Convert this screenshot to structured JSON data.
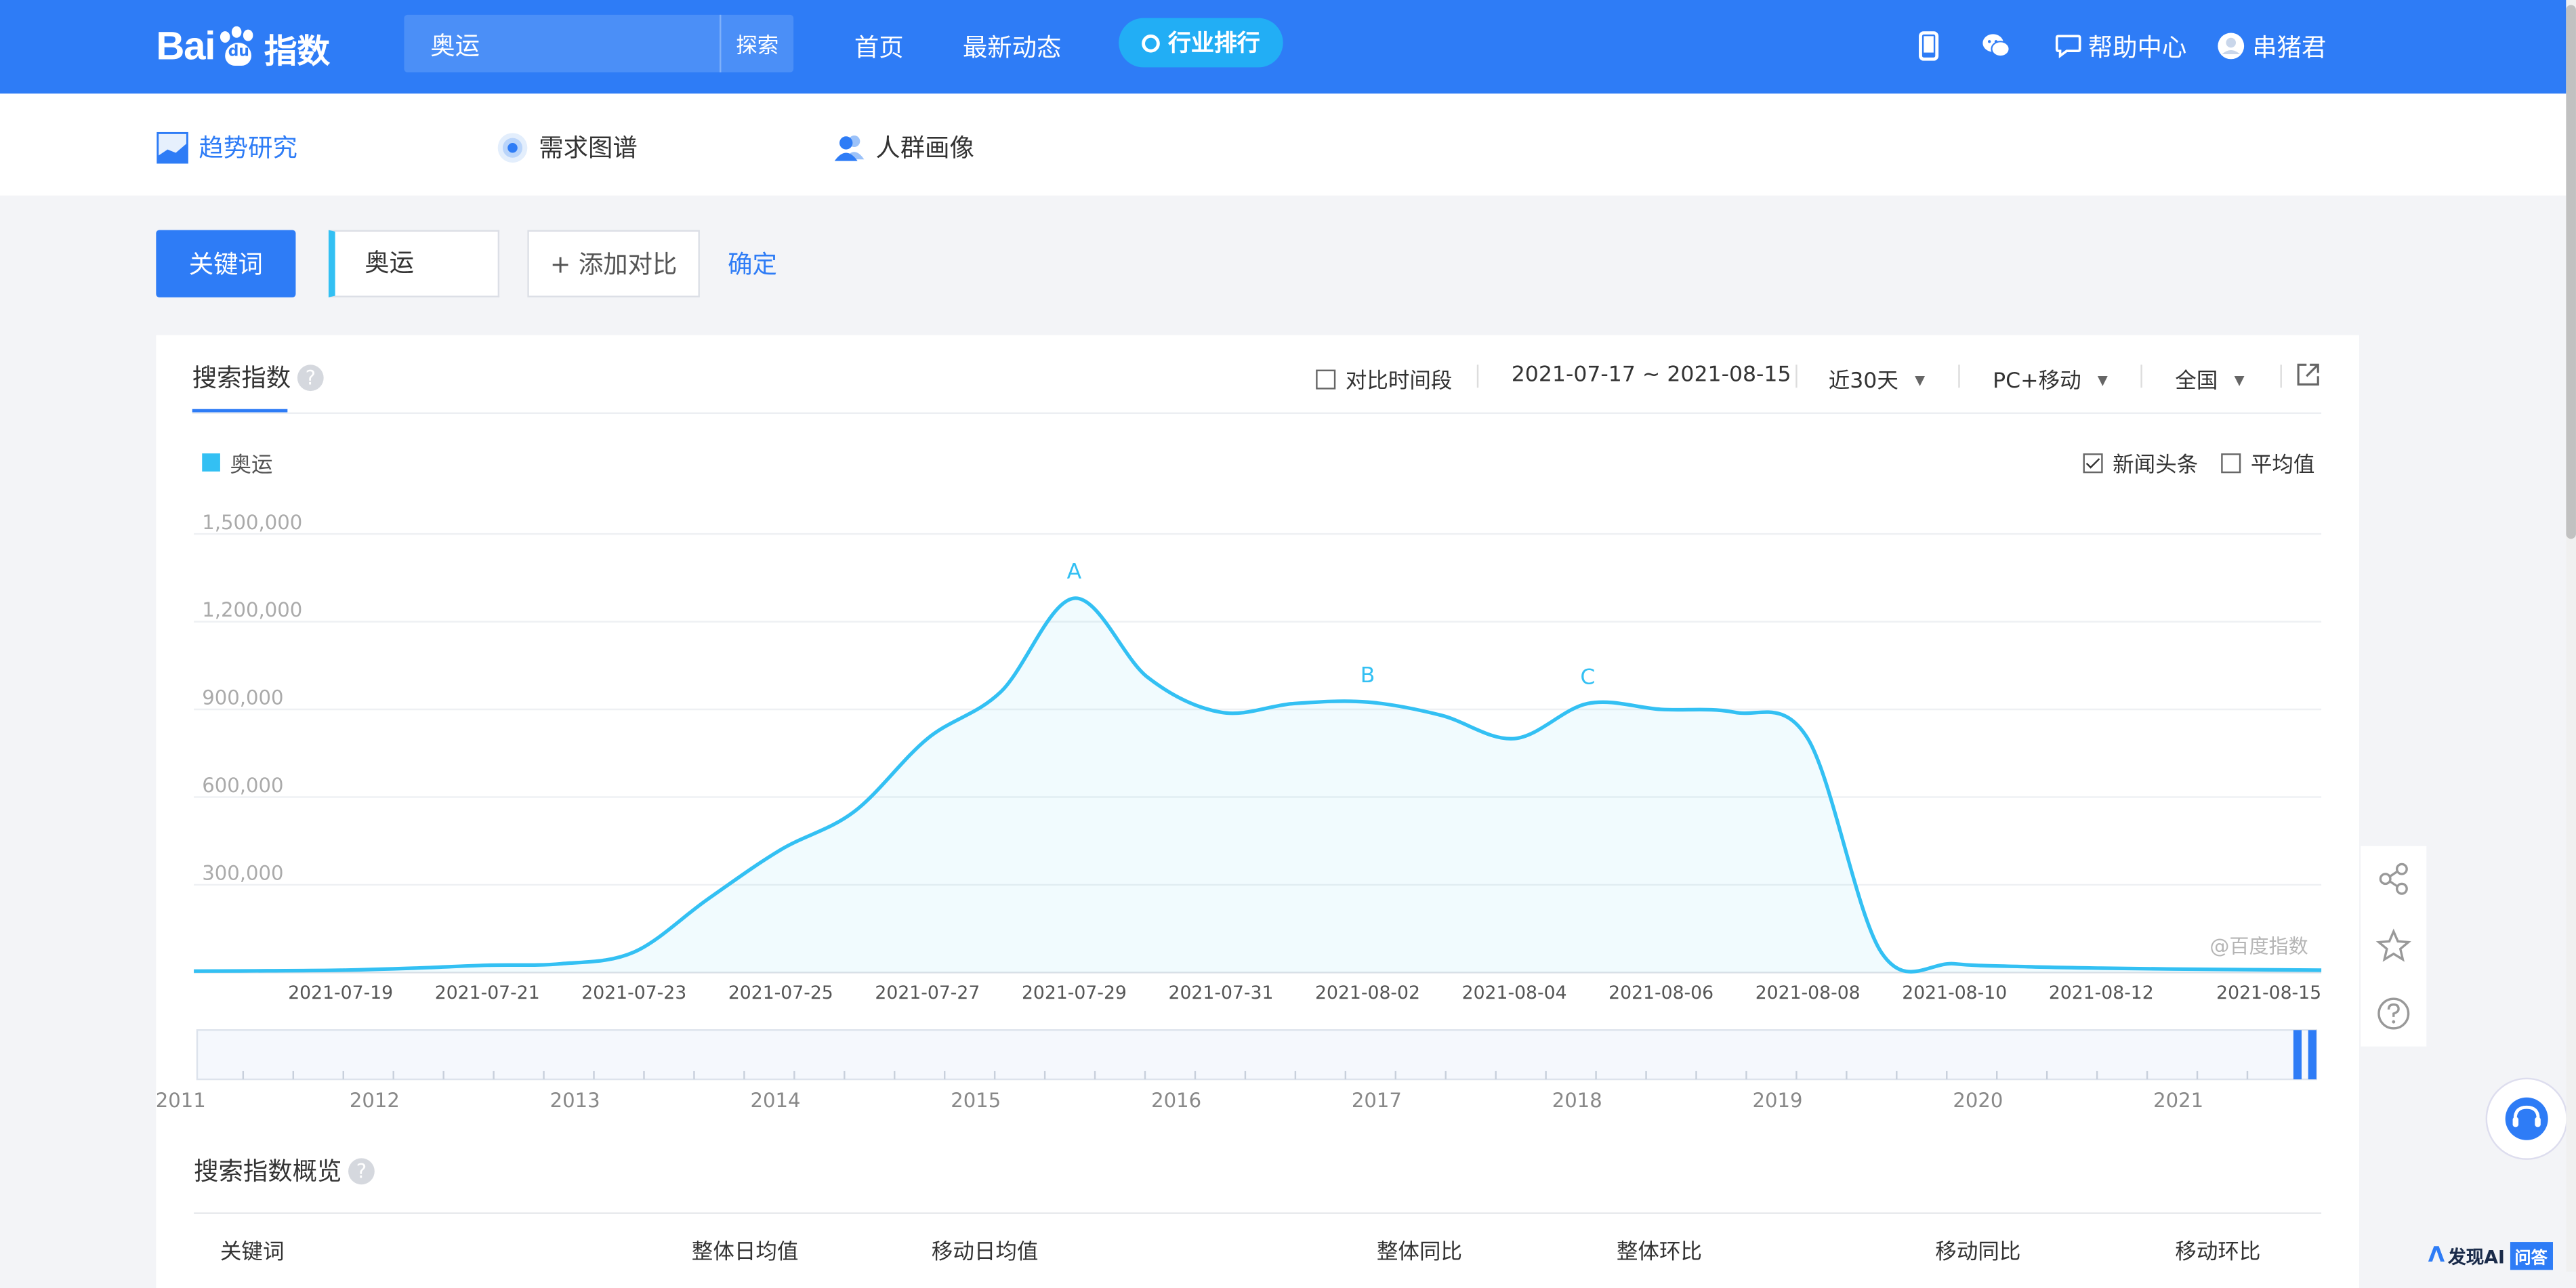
{
  "brand": {
    "logo_text": "Bai",
    "logo_du": "du",
    "logo_zh": "指数"
  },
  "search": {
    "value": "奥运",
    "button": "探索"
  },
  "nav": {
    "home": "首页",
    "news": "最新动态",
    "ranking": "行业排行"
  },
  "topright": {
    "help": "帮助中心",
    "user": "串猪君"
  },
  "subnav": {
    "trend": "趋势研究",
    "demand": "需求图谱",
    "crowd": "人群画像"
  },
  "keyword_row": {
    "label": "关键词",
    "keyword": "奥运",
    "add": "+ 添加对比",
    "confirm": "确定"
  },
  "card": {
    "title": "搜索指数",
    "help_mark": "?",
    "compare_period": "对比时间段",
    "date_range": "2021-07-17 ~ 2021-08-15",
    "period": "近30天",
    "device": "PC+移动",
    "region": "全国",
    "news_headlines": "新闻头条",
    "average": "平均值",
    "watermark": "@百度指数"
  },
  "chart_data": {
    "type": "area",
    "series": [
      {
        "name": "奥运",
        "color": "#33c0f3",
        "x": [
          "2021-07-17",
          "2021-07-18",
          "2021-07-19",
          "2021-07-20",
          "2021-07-21",
          "2021-07-22",
          "2021-07-23",
          "2021-07-24",
          "2021-07-25",
          "2021-07-26",
          "2021-07-27",
          "2021-07-28",
          "2021-07-29",
          "2021-07-30",
          "2021-07-31",
          "2021-08-01",
          "2021-08-02",
          "2021-08-03",
          "2021-08-04",
          "2021-08-05",
          "2021-08-06",
          "2021-08-07",
          "2021-08-08",
          "2021-08-09",
          "2021-08-10",
          "2021-08-11",
          "2021-08-12",
          "2021-08-13",
          "2021-08-14",
          "2021-08-15"
        ],
        "values": [
          5000,
          6000,
          8000,
          15000,
          25000,
          30000,
          70000,
          250000,
          420000,
          550000,
          800000,
          960000,
          1280000,
          1010000,
          890000,
          920000,
          925000,
          880000,
          800000,
          920000,
          900000,
          890000,
          800000,
          70000,
          30000,
          20000,
          15000,
          12000,
          10000,
          8000
        ]
      }
    ],
    "yticks": [
      "1,500,000",
      "1,200,000",
      "900,000",
      "600,000",
      "300,000"
    ],
    "ylim": [
      0,
      1500000
    ],
    "xticks": [
      "2021-07-19",
      "2021-07-21",
      "2021-07-23",
      "2021-07-25",
      "2021-07-27",
      "2021-07-29",
      "2021-07-31",
      "2021-08-02",
      "2021-08-04",
      "2021-08-06",
      "2021-08-08",
      "2021-08-10",
      "2021-08-12",
      "2021-08-15"
    ],
    "annotations": [
      {
        "label": "A",
        "date": "2021-07-29"
      },
      {
        "label": "B",
        "date": "2021-08-02"
      },
      {
        "label": "C",
        "date": "2021-08-05"
      }
    ],
    "grid": true,
    "legend": "top-left",
    "timeline_years": [
      "2011",
      "2012",
      "2013",
      "2014",
      "2015",
      "2016",
      "2017",
      "2018",
      "2019",
      "2020",
      "2021"
    ]
  },
  "overview": {
    "title": "搜索指数概览",
    "columns": [
      "关键词",
      "整体日均值",
      "移动日均值",
      "整体同比",
      "整体环比",
      "移动同比",
      "移动环比"
    ]
  },
  "badge": {
    "text": "发现AI",
    "tag": "问答"
  },
  "colors": {
    "brand_blue": "#2e7cf6",
    "series": "#33c0f3",
    "rank_pill": "#22aef5"
  }
}
